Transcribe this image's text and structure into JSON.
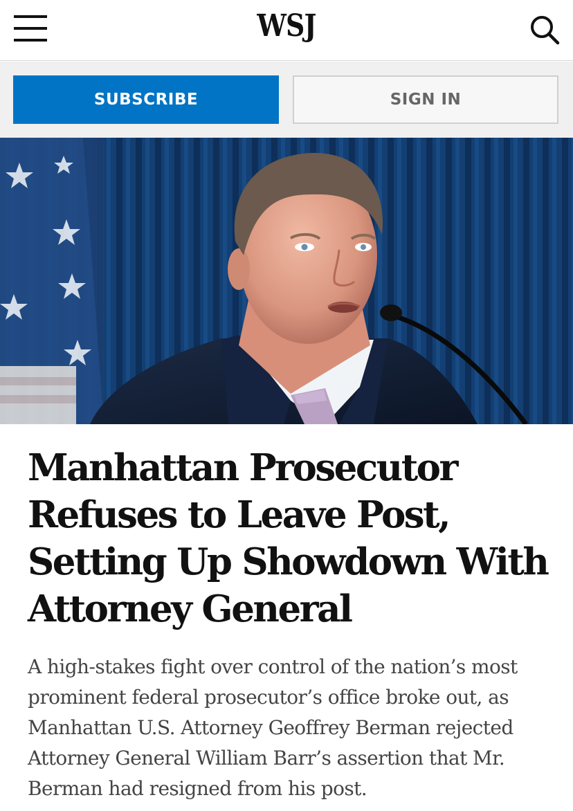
{
  "header": {
    "logo_text": "WSJ",
    "menu_icon": "hamburger-menu-icon",
    "search_icon": "search-icon"
  },
  "auth": {
    "subscribe_label": "SUBSCRIBE",
    "signin_label": "SIGN IN"
  },
  "colors": {
    "subscribe_bg": "#0274c5",
    "signin_text": "#666666",
    "headline_text": "#111111",
    "body_text": "#444444"
  },
  "article": {
    "headline_lines": [
      "Manhattan Prosecutor",
      "Refuses to Leave Post,",
      "Setting Up Showdown With",
      "Attorney General"
    ],
    "summary_lines": [
      "A high-stakes fight over control of the nation’s most",
      "prominent federal prosecutor’s office broke out, as",
      "Manhattan U.S. Attorney Geoffrey Berman rejected",
      "Attorney General William Barr’s assertion that Mr.",
      "Berman had resigned from his post."
    ]
  }
}
